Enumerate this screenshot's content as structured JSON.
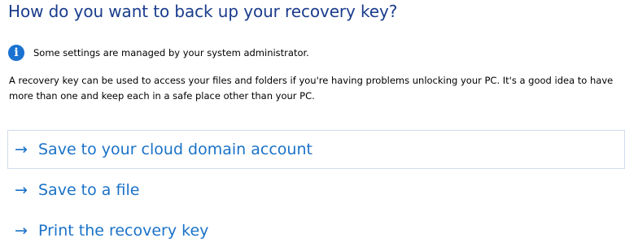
{
  "header": {
    "title": "How do you want to back up your recovery key?"
  },
  "info": {
    "icon": "info-icon",
    "glyph": "i",
    "text": "Some settings are managed by your system administrator."
  },
  "description": "A recovery key can be used to access your files and folders if you're having problems unlocking your PC. It's a good idea to have more than one and keep each in a safe place other than your PC.",
  "options": [
    {
      "arrow": "→",
      "label": "Save to your cloud domain account",
      "selected": true
    },
    {
      "arrow": "→",
      "label": "Save to a file",
      "selected": false
    },
    {
      "arrow": "→",
      "label": "Print the recovery key",
      "selected": false
    }
  ],
  "colors": {
    "title": "#1a3c8c",
    "link": "#1a72c8",
    "info_icon_bg": "#1a72d0",
    "selection_border": "#d3dcec"
  }
}
